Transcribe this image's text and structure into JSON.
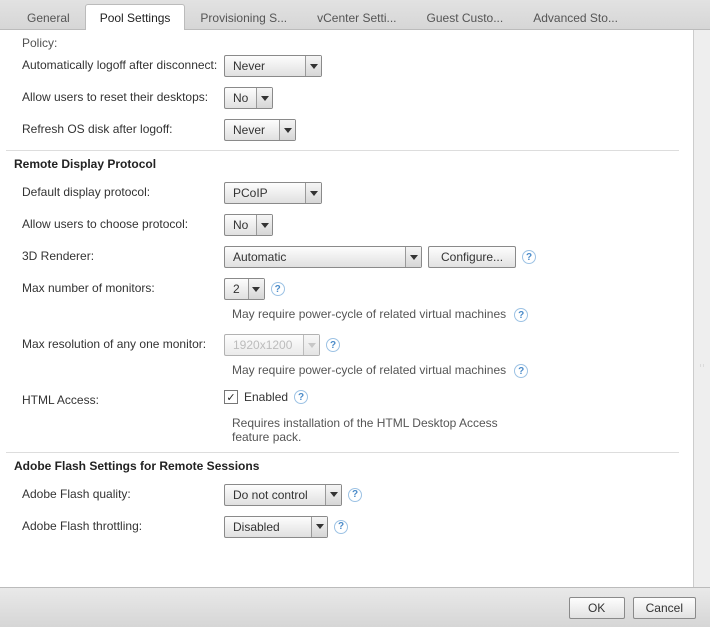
{
  "tabs": {
    "t0": "General",
    "t1": "Pool Settings",
    "t2": "Provisioning S...",
    "t3": "vCenter Setti...",
    "t4": "Guest Custo...",
    "t5": "Advanced Sto..."
  },
  "policy_cut": "Policy:",
  "rows": {
    "auto_logoff_label": "Automatically logoff after disconnect:",
    "auto_logoff_value": "Never",
    "allow_reset_label": "Allow users to reset their desktops:",
    "allow_reset_value": "No",
    "refresh_os_label": "Refresh OS disk after logoff:",
    "refresh_os_value": "Never"
  },
  "rdp": {
    "header": "Remote Display Protocol",
    "default_proto_label": "Default display protocol:",
    "default_proto_value": "PCoIP",
    "allow_choose_label": "Allow users to choose protocol:",
    "allow_choose_value": "No",
    "renderer_label": "3D Renderer:",
    "renderer_value": "Automatic",
    "configure_btn": "Configure...",
    "max_monitors_label": "Max number of monitors:",
    "max_monitors_value": "2",
    "powercycle_note": "May require power-cycle of related virtual machines",
    "max_res_label": "Max resolution of any one monitor:",
    "max_res_value": "1920x1200",
    "html_label": "HTML Access:",
    "html_enabled": "Enabled",
    "html_note": "Requires installation of the HTML Desktop Access feature pack."
  },
  "flash": {
    "header": "Adobe Flash Settings for Remote Sessions",
    "quality_label": "Adobe Flash quality:",
    "quality_value": "Do not control",
    "throttle_label": "Adobe Flash throttling:",
    "throttle_value": "Disabled"
  },
  "footer": {
    "ok": "OK",
    "cancel": "Cancel"
  }
}
